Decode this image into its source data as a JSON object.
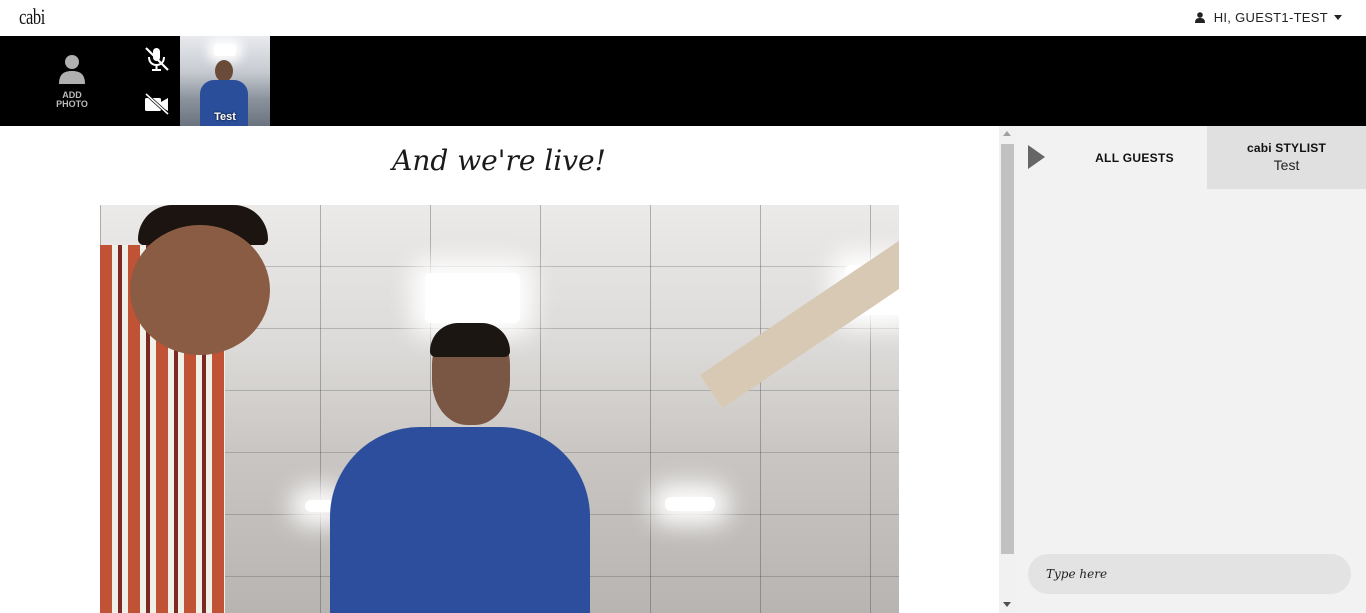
{
  "topbar": {
    "logo": "cabi",
    "user_greeting": "HI, GUEST1-TEST",
    "user_icon": "user-icon",
    "caret_icon": "caret-down-icon"
  },
  "strip": {
    "add_photo_label": "ADD PHOTO",
    "add_photo_icon": "person-silhouette-icon",
    "mic_icon": "mic-muted-icon",
    "camera_icon": "camera-off-icon",
    "self_thumbnail_name": "Test"
  },
  "main": {
    "headline": "And we're live!"
  },
  "panel": {
    "toggle_icon": "play-triangle-icon",
    "tab_all_guests": "ALL GUESTS",
    "tab_stylist_title": "cabi STYLIST",
    "tab_stylist_name": "Test",
    "chat_placeholder": "Type here"
  },
  "colors": {
    "strip_bg": "#000000",
    "panel_bg": "#f2f2f2",
    "active_tab_bg": "#e0e0e0"
  }
}
